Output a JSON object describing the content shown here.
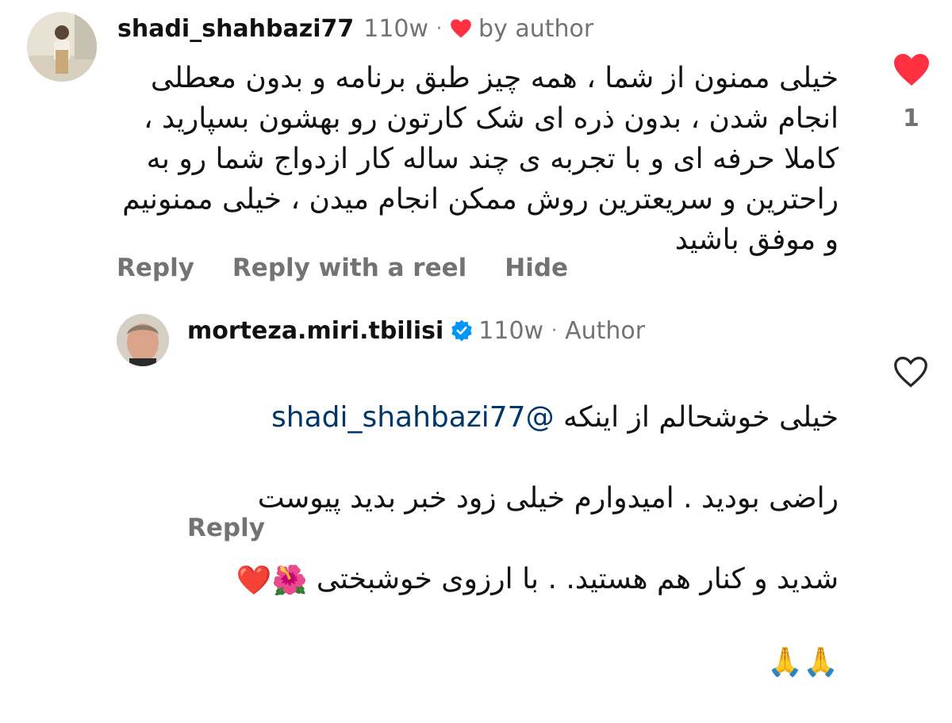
{
  "comments": [
    {
      "username": "shadi_shahbazi77",
      "time": "110w",
      "liked_by": "by author",
      "text": "خیلی ممنون از شما ، همه چیز طبق برنامه و بدون معطلی انجام شدن ، بدون ذره ای شک کارتون رو بهشون بسپارید ، کاملا حرفه ای و با تجربه ی چند ساله  کار ازدواج شما رو به راحترین و سریعترین روش ممکن انجام میدن ، خیلی ممنونیم و موفق باشید",
      "like_count": "1",
      "actions": [
        "Reply",
        "Reply with a reel",
        "Hide"
      ]
    }
  ],
  "reply": {
    "username": "morteza.miri.tbilisi",
    "time": "110w",
    "role": "Author",
    "mention": "@shadi_shahbazi77",
    "text_after_mention": "خیلی خوشحالم از اینکه",
    "text_line2": "راضی بودید . امیدوارم خیلی زود خبر بدید پیوست",
    "text_line3": "شدید و کنار هم هستید. . با ارزوی خوشبختی",
    "emoji_line3": "🌺❤️",
    "emoji_line4": "🙏🙏",
    "reply_label": "Reply"
  },
  "colors": {
    "like_red": "#ff3040",
    "meta_gray": "#737373",
    "mention_blue": "#00376b",
    "verified_blue": "#0095f6"
  },
  "icons": [
    "heart-icon",
    "verified-badge-icon",
    "heart-outline-icon"
  ]
}
